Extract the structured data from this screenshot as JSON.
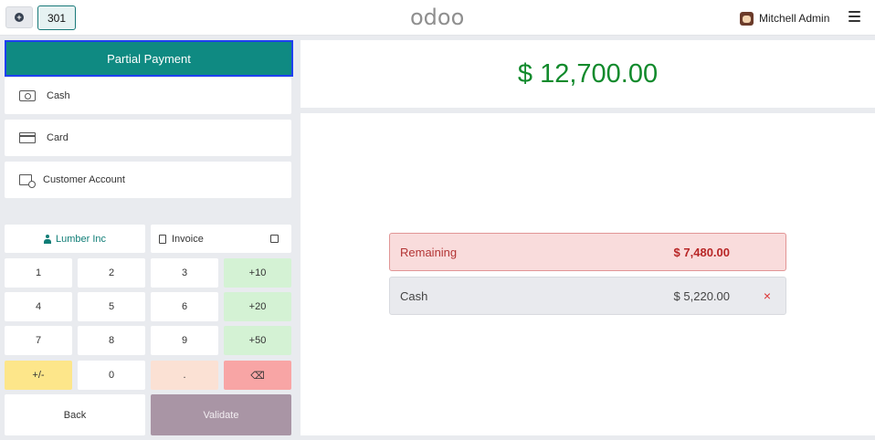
{
  "topbar": {
    "order_number": "301",
    "logo_text": "odoo",
    "user_name": "Mitchell Admin"
  },
  "payment_methods": {
    "selected": "Partial Payment",
    "items": [
      {
        "label": "Cash",
        "icon": "cash-icon"
      },
      {
        "label": "Card",
        "icon": "card-icon"
      },
      {
        "label": "Customer Account",
        "icon": "customer-account-icon"
      }
    ]
  },
  "customer": {
    "label": "Lumber Inc"
  },
  "invoice": {
    "label": "Invoice",
    "checked": false
  },
  "numpad": {
    "k1": "1",
    "k2": "2",
    "k3": "3",
    "k_plus10": "+10",
    "k4": "4",
    "k5": "5",
    "k6": "6",
    "k_plus20": "+20",
    "k7": "7",
    "k8": "8",
    "k9": "9",
    "k_plus50": "+50",
    "k_sign": "+/-",
    "k0": "0",
    "k_dot": ".",
    "k_back": "⌫"
  },
  "actions": {
    "back": "Back",
    "validate": "Validate"
  },
  "summary": {
    "total": "$ 12,700.00",
    "remaining_label": "Remaining",
    "remaining_amount": "$ 7,480.00",
    "paid_lines": [
      {
        "method": "Cash",
        "amount": "$ 5,220.00",
        "remove": "×"
      }
    ]
  },
  "colors": {
    "primary": "#0f8a82",
    "total_green": "#118a2c",
    "remaining_red": "#b82626",
    "validate_disabled": "#a995a5"
  }
}
